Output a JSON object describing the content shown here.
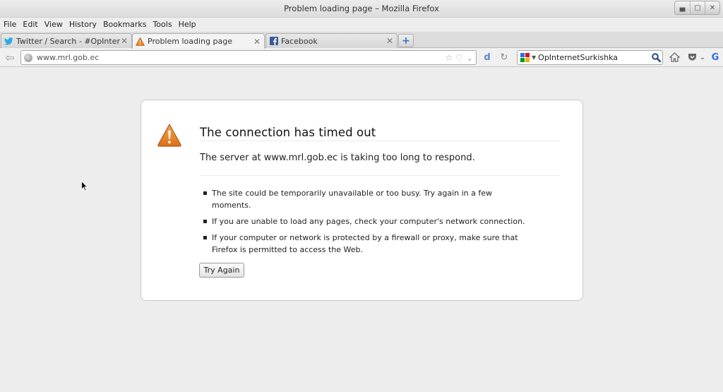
{
  "window": {
    "title": "Problem loading page – Mozilla Firefox"
  },
  "menu": [
    "File",
    "Edit",
    "View",
    "History",
    "Bookmarks",
    "Tools",
    "Help"
  ],
  "tabs": [
    {
      "label": "Twitter / Search - #OpInter...",
      "icon": "twitter-bird-icon"
    },
    {
      "label": "Problem loading page",
      "icon": "warning-icon",
      "active": true
    },
    {
      "label": "Facebook",
      "icon": "facebook-icon"
    }
  ],
  "navbar": {
    "url": "www.mrl.gob.ec",
    "search_value": "OpInternetSurkishka"
  },
  "error": {
    "title": "The connection has timed out",
    "description": "The server at www.mrl.gob.ec is taking too long to respond.",
    "bullets": [
      "The site could be temporarily unavailable or too busy. Try again in a few moments.",
      "If you are unable to load any pages, check your computer's network connection.",
      "If your computer or network is protected by a firewall or proxy, make sure that Firefox is permitted to access the Web."
    ],
    "button_label": "Try Again"
  },
  "colors": {
    "warning_orange": "#e8862a",
    "facebook_blue": "#3b5998",
    "twitter_blue": "#2fa9e0"
  }
}
